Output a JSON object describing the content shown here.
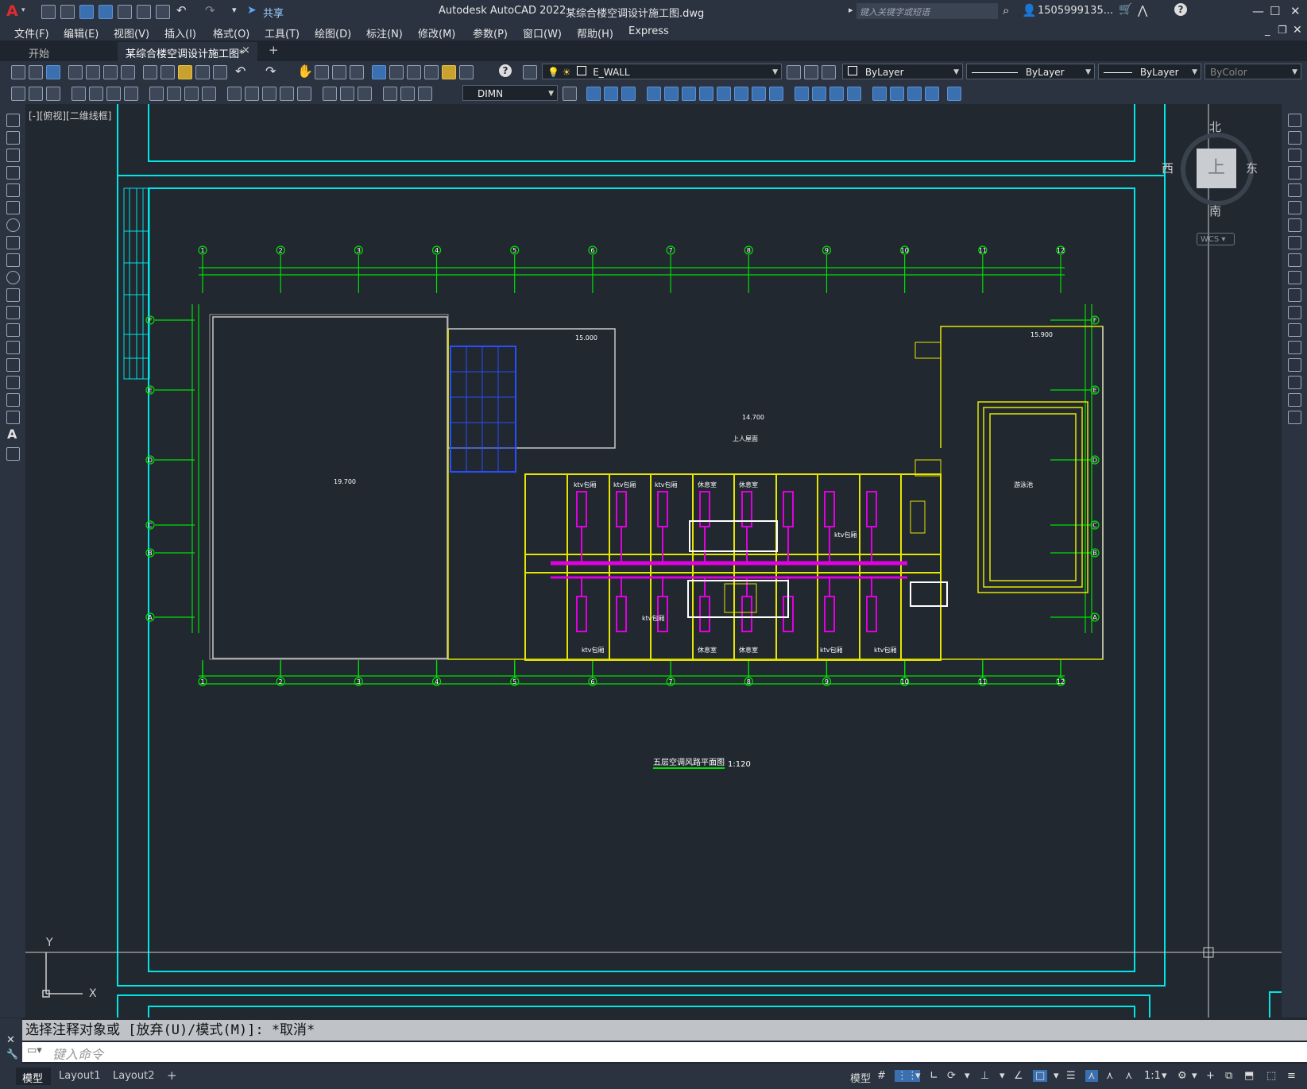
{
  "app": {
    "logo": "A",
    "share_label": "共享",
    "window_title": "Autodesk AutoCAD 2022",
    "file_name": "某综合楼空调设计施工图.dwg",
    "search_placeholder": "键入关键字或短语",
    "user_name": "1505999135...",
    "help_label": "?"
  },
  "menu": [
    "文件(F)",
    "编辑(E)",
    "视图(V)",
    "插入(I)",
    "格式(O)",
    "工具(T)",
    "绘图(D)",
    "标注(N)",
    "修改(M)",
    "参数(P)",
    "窗口(W)",
    "帮助(H)",
    "Express"
  ],
  "tabs": {
    "start": "开始",
    "active": "某综合楼空调设计施工图*",
    "close": "×",
    "add": "+"
  },
  "toolbar": {
    "layer_name": "E_WALL",
    "color": "ByLayer",
    "linetype": "ByLayer",
    "lineweight": "ByLayer",
    "plotstyle": "ByColor",
    "dim_style": "DIMN"
  },
  "viewport": {
    "label": "[-][俯视][二维线框]",
    "compass": {
      "north": "北",
      "south": "南",
      "east": "东",
      "west": "西",
      "top": "上"
    },
    "wcs": "WCS",
    "ucs_x": "X",
    "ucs_y": "Y"
  },
  "drawing": {
    "axis_numbers": [
      "1",
      "2",
      "3",
      "4",
      "5",
      "6",
      "7",
      "8",
      "9",
      "10",
      "11",
      "12"
    ],
    "axis_letters": [
      "F",
      "E",
      "D",
      "C",
      "B",
      "A"
    ],
    "elevations": [
      "19.700",
      "15.000",
      "14.700",
      "15.900"
    ],
    "roof_label": "上人屋面",
    "pool_label": "游泳池",
    "title": "五层空调风路平面图",
    "scale": "1:120",
    "rooms": [
      "ktv包厢",
      "ktv包厢",
      "ktv包厢",
      "休息室",
      "休息室",
      "ktv包厢",
      "ktv包厢",
      "ktv包厢",
      "休息室",
      "休息室",
      "ktv包厢",
      "ktv包厢"
    ]
  },
  "command": {
    "history": "选择注释对象或 [放弃(U)/模式(M)]: *取消*",
    "input_placeholder": "键入命令"
  },
  "layout_tabs": [
    "模型",
    "Layout1",
    "Layout2",
    "+"
  ],
  "status": {
    "model": "模型",
    "scale": "1:1"
  },
  "colors": {
    "background": "#212830",
    "frame": "#00e5e5",
    "axis": "#00e000",
    "wall": "#e6e600",
    "duct": "#e000e0",
    "text": "#ffffff"
  }
}
